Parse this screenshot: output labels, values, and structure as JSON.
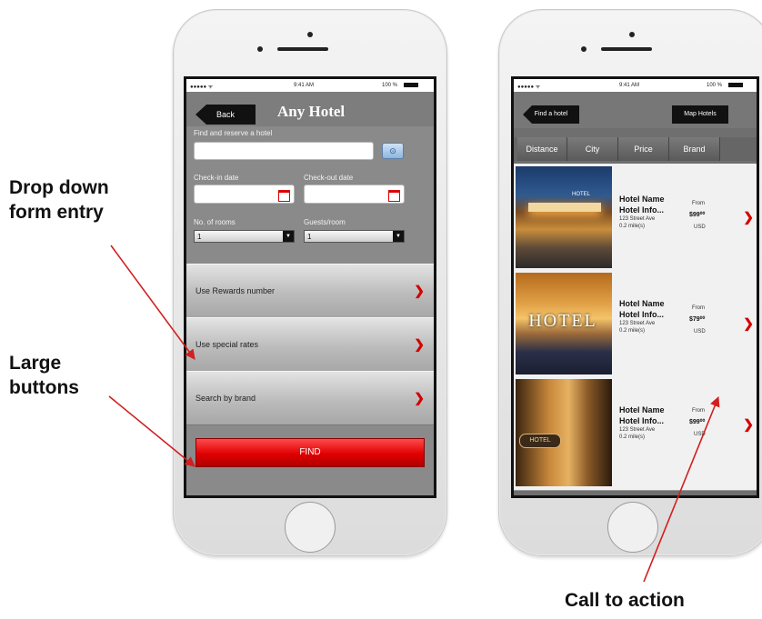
{
  "annotations": {
    "dropdown": [
      "Drop down",
      "form entry"
    ],
    "large_buttons": [
      "Large",
      "buttons"
    ],
    "call_to_action": "Call to action",
    "arrow_color": "#d21f1f"
  },
  "status_bar": {
    "carrier": "●●●●● ᯤ",
    "time": "9:41 AM",
    "battery": "100 %"
  },
  "form_screen": {
    "back_label": "Back",
    "title": "Any Hotel",
    "find_label": "Find and reserve a hotel",
    "checkin_label": "Check-in date",
    "checkout_label": "Check-out date",
    "rooms_label": "No. of rooms",
    "guests_label": "Guests/room",
    "rooms_value": "1",
    "guests_value": "1",
    "buttons": [
      "Use Rewards number",
      "Use special rates",
      "Search by brand"
    ],
    "find_button": "FIND"
  },
  "results_screen": {
    "find_hotel_button": "Find a hotel",
    "map_button": "Map Hotels",
    "tabs": [
      "Distance",
      "City",
      "Price",
      "Brand"
    ],
    "hotels": [
      {
        "name": "Hotel Name",
        "info": "Hotel Info...",
        "address": "123 Street Ave",
        "distance": "0.2 mile(s)",
        "from": "From",
        "price": "$99⁰⁰",
        "currency": "USD",
        "image_caption": "HOTEL"
      },
      {
        "name": "Hotel Name",
        "info": "Hotel Info...",
        "address": "123 Street Ave",
        "distance": "0.2 mile(s)",
        "from": "From",
        "price": "$79⁰⁰",
        "currency": "USD",
        "image_caption": "HOTEL"
      },
      {
        "name": "Hotel Name",
        "info": "Hotel Info...",
        "address": "123 Street Ave",
        "distance": "0.2 mile(s)",
        "from": "From",
        "price": "$99⁰⁰",
        "currency": "USD",
        "image_caption": "HOTEL"
      }
    ]
  },
  "colors": {
    "accent_red": "#e00000",
    "header_gray": "#7d7d7d",
    "screen_gray": "#8a8a8a"
  }
}
